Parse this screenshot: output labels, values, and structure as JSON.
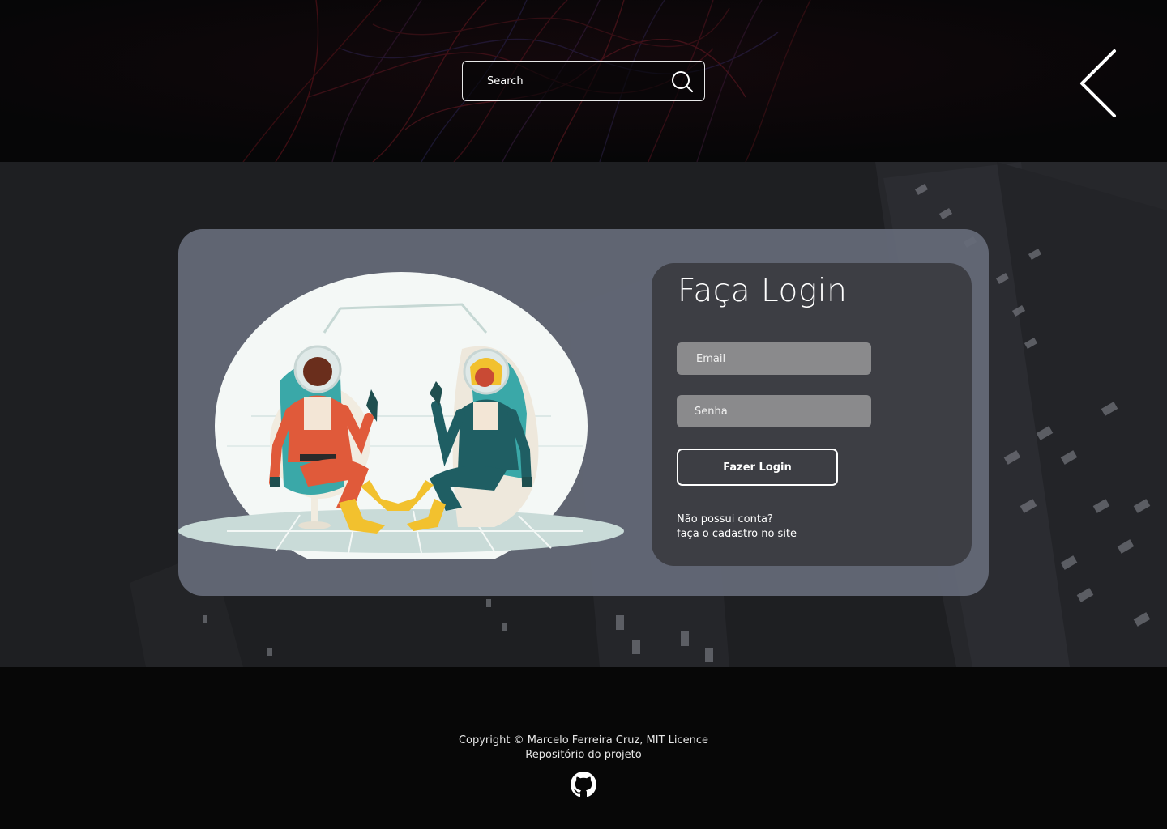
{
  "header": {
    "search": {
      "placeholder": "Search"
    },
    "back_icon": "chevron-left-icon",
    "search_icon": "search-icon"
  },
  "login": {
    "title": "Faça Login",
    "email_placeholder": "Email",
    "password_placeholder": "Senha",
    "submit_label": "Fazer Login",
    "signup_line1": "Não possui conta?",
    "signup_line2": "faça o cadastro no site"
  },
  "illustration": {
    "description_icon": "astronauts-illustration"
  },
  "footer": {
    "copyright": "Copyright © Marcelo Ferreira Cruz, MIT Licence",
    "repo_link": "Repositório do projeto",
    "github_icon": "github-icon"
  },
  "colors": {
    "page_bg": "#070707",
    "main_bg": "#1e1f22",
    "card_bg": "#656a78",
    "panel_bg": "#3d3e44",
    "input_bg": "#8a8a8c",
    "suit_red": "#e05a3a",
    "suit_teal": "#1f5e63",
    "boots_yellow": "#f2c12e"
  }
}
